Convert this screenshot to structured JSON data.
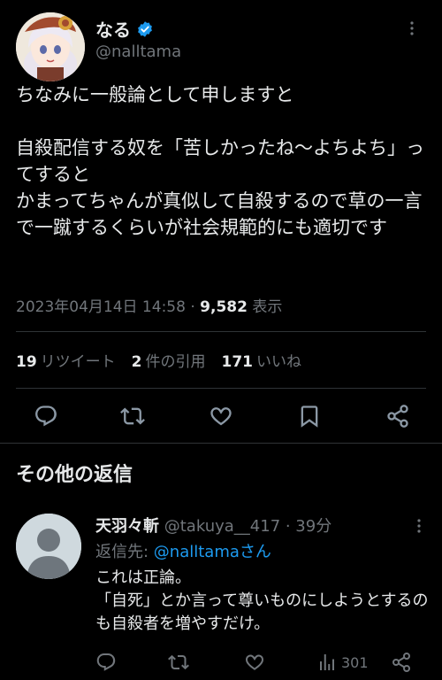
{
  "tweet": {
    "author_name": "なる",
    "author_handle": "@nalltama",
    "text": "ちなみに一般論として申しますと\n\n自殺配信する奴を「苦しかったね〜よちよち」ってすると\nかまってちゃんが真似して自殺するので草の一言で一蹴するくらいが社会規範的にも適切です",
    "timestamp": "2023年04月14日 14:58",
    "separator": " · ",
    "views_count": "9,582",
    "views_label": " 表示"
  },
  "stats": {
    "retweets_count": "19",
    "retweets_label": "リツイート",
    "quotes_count": "2",
    "quotes_label": "件の引用",
    "likes_count": "171",
    "likes_label": "いいね"
  },
  "actions": {
    "icons": [
      "reply-icon",
      "retweet-icon",
      "like-icon",
      "bookmark-icon",
      "share-icon"
    ]
  },
  "replies_section": {
    "title": "その他の返信"
  },
  "reply": {
    "name": "天羽々斬",
    "handle": "@takuya__417",
    "time": " · 39分",
    "reply_to_label": "返信先: ",
    "reply_to_mention": "@nalltamaさん",
    "text": "これは正論。\n「自死」とか言って尊いものにしようとするのも自殺者を増やすだけ。",
    "views_count": "301"
  },
  "colors": {
    "background": "#000000",
    "text": "#e7e9ea",
    "muted": "#71767b",
    "accent": "#1d9bf0",
    "divider": "#2f3336"
  }
}
